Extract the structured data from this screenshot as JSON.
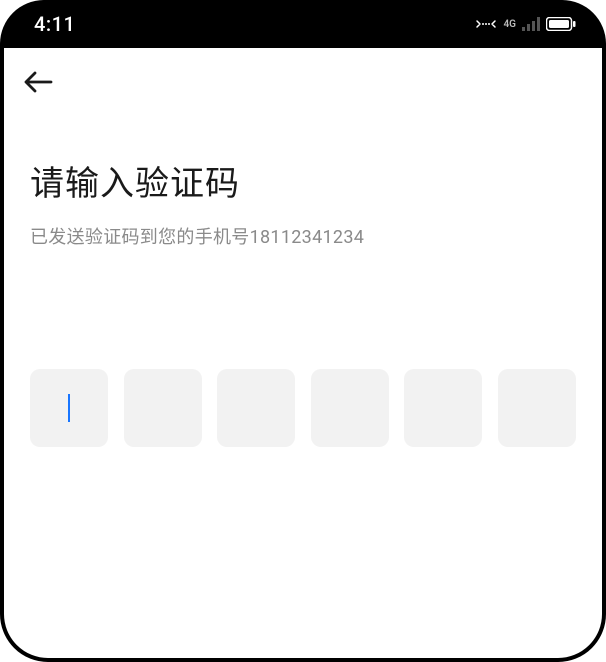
{
  "status_bar": {
    "time": "4:11",
    "network_label": "4G"
  },
  "page": {
    "title": "请输入验证码",
    "subtitle": "已发送验证码到您的手机号18112341234"
  },
  "code_input": {
    "length": 6,
    "active_index": 0,
    "values": [
      "",
      "",
      "",
      "",
      "",
      ""
    ]
  }
}
